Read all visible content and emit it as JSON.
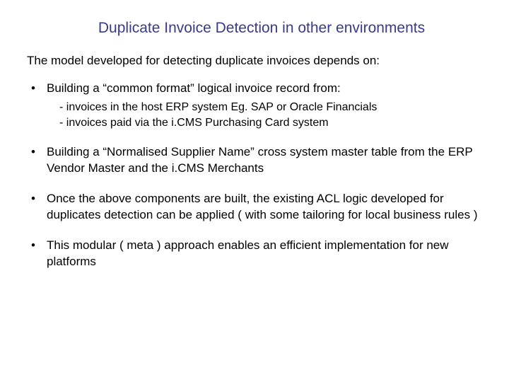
{
  "title": "Duplicate Invoice Detection in other environments",
  "intro": "The model developed for detecting duplicate invoices depends on:",
  "bullets": [
    {
      "text": "Building a “common format” logical invoice record from:",
      "subs": [
        "- invoices in the host ERP system Eg. SAP or Oracle Financials",
        "- invoices paid via the i.CMS Purchasing Card system"
      ]
    },
    {
      "text": "Building a “Normalised Supplier Name” cross system master table from the ERP Vendor Master and the i.CMS Merchants",
      "subs": []
    },
    {
      "text": "Once the above components are built, the existing ACL logic developed for duplicates detection can be applied ( with some tailoring for local business rules )",
      "subs": []
    },
    {
      "text": "This modular ( meta ) approach enables an efficient implementation for new platforms",
      "subs": []
    }
  ]
}
